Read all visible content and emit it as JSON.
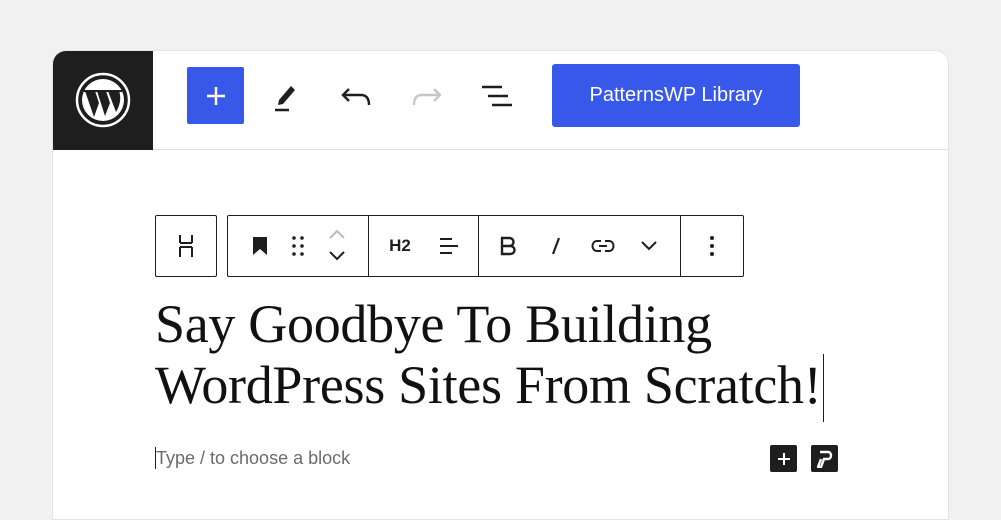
{
  "header": {
    "logo_icon": "wordpress-logo-icon",
    "add_block_icon": "plus-icon",
    "tools_icon": "pencil-icon",
    "undo_icon": "undo-icon",
    "redo_icon": "redo-icon",
    "list_view_icon": "list-view-icon",
    "library_button_label": "PatternsWP Library",
    "accent_color": "#3858e9"
  },
  "block_toolbar": {
    "block_type_icon": "heading-block-icon",
    "bookmark_icon": "bookmark-icon",
    "drag_icon": "drag-handle-icon",
    "move_icons": [
      "chevron-up-icon",
      "chevron-down-icon"
    ],
    "heading_level_label": "H2",
    "align_icon": "align-left-icon",
    "bold_icon": "bold-icon",
    "italic_icon": "italic-icon",
    "link_icon": "link-icon",
    "more_formatting_icon": "chevron-down-icon",
    "options_icon": "more-vertical-icon"
  },
  "content": {
    "heading_line1": "Say Goodbye To Building",
    "heading_line2": "WordPress Sites From Scratch!",
    "placeholder": "Type / to choose a block"
  },
  "inserter": {
    "add_icon": "plus-icon",
    "patterns_icon": "patternswp-icon"
  }
}
